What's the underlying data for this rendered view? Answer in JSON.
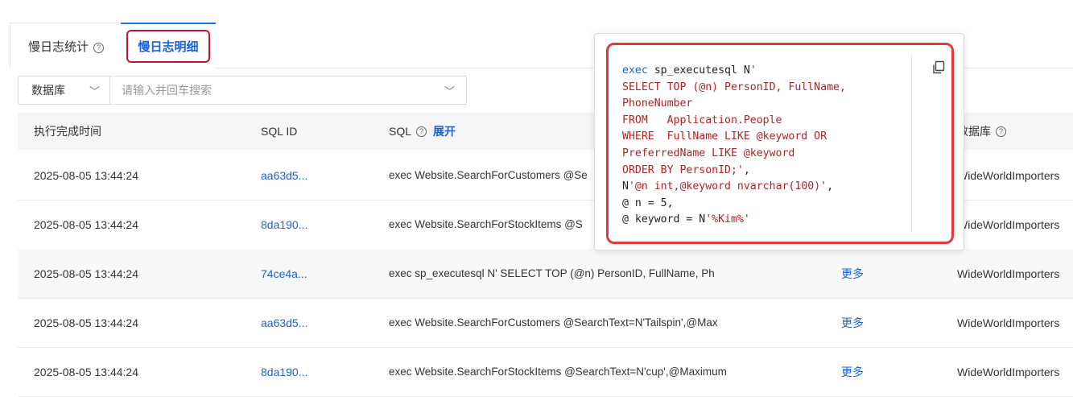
{
  "tabs": [
    {
      "label": "慢日志统计",
      "help": "?"
    },
    {
      "label": "慢日志明细"
    }
  ],
  "filter": {
    "db_label": "数据库",
    "search_placeholder": "请输入并回车搜索"
  },
  "table": {
    "headers": {
      "time": "执行完成时间",
      "sql_id": "SQL ID",
      "sql": "SQL",
      "expand": "展开",
      "database": "数据库"
    },
    "rows": [
      {
        "time": "2025-08-05 13:44:24",
        "sql_id": "aa63d5...",
        "sql": "exec Website.SearchForCustomers @Se",
        "more": "",
        "db": "WideWorldImporters"
      },
      {
        "time": "2025-08-05 13:44:24",
        "sql_id": "8da190...",
        "sql": "exec Website.SearchForStockItems @S",
        "more": "",
        "db": "WideWorldImporters"
      },
      {
        "time": "2025-08-05 13:44:24",
        "sql_id": "74ce4a...",
        "sql": "exec sp_executesql N' SELECT TOP (@n) PersonID, FullName, Ph",
        "more": "更多",
        "db": "WideWorldImporters"
      },
      {
        "time": "2025-08-05 13:44:24",
        "sql_id": "aa63d5...",
        "sql": "exec Website.SearchForCustomers @SearchText=N'Tailspin',@Max",
        "more": "更多",
        "db": "WideWorldImporters"
      },
      {
        "time": "2025-08-05 13:44:24",
        "sql_id": "8da190...",
        "sql": "exec Website.SearchForStockItems @SearchText=N'cup',@Maximum",
        "more": "更多",
        "db": "WideWorldImporters"
      }
    ]
  },
  "popup": {
    "line1_kw": "exec",
    "line1_fn": " sp_executesql N",
    "line1_q": "'",
    "l2": "SELECT TOP (@n) PersonID, FullName,",
    "l3": "PhoneNumber",
    "l4": "FROM   Application.People",
    "l5": "WHERE  FullName LIKE @keyword OR",
    "l6": "PreferredName LIKE @keyword",
    "l7": "ORDER BY PersonID;'",
    "l7b": ",",
    "l8a": "N",
    "l8b": "'@n int,@keyword nvarchar(100)'",
    "l8c": ",",
    "l9": "@ n = 5,",
    "l10a": "@ keyword = N",
    "l10b": "'%Kim%'",
    "copy_icon": "copy-icon"
  }
}
